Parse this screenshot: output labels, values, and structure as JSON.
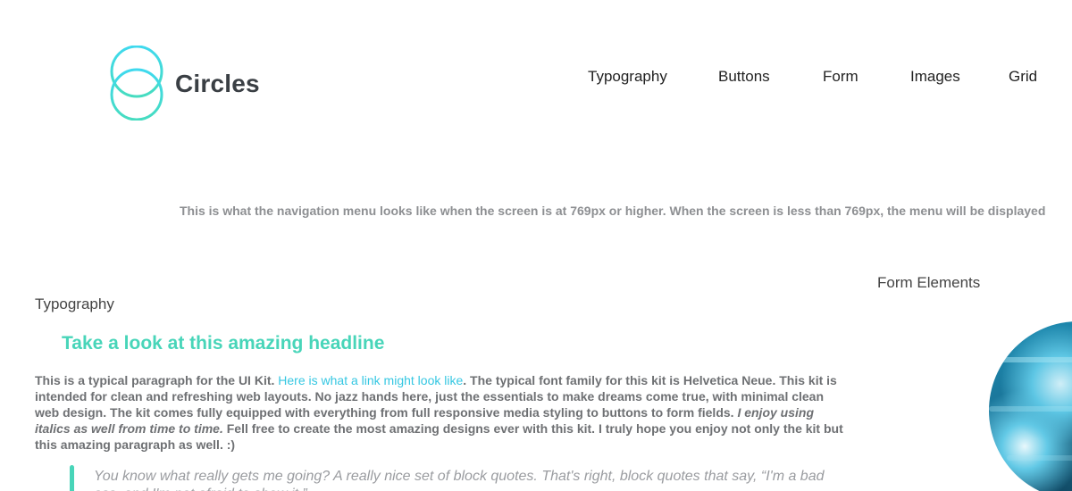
{
  "brand": {
    "name": "Circles",
    "logo_icon": "circles-logo-icon",
    "accent_color": "#48d5b9",
    "link_color": "#35c7e2"
  },
  "nav": {
    "items": [
      {
        "label": "Typography"
      },
      {
        "label": "Buttons"
      },
      {
        "label": "Form"
      },
      {
        "label": "Images"
      },
      {
        "label": "Grid"
      }
    ]
  },
  "info_text": "This is what the navigation menu looks like when the screen is at 769px or higher. When the screen is less than 769px, the menu will be displayed",
  "typography": {
    "title": "Typography",
    "headline": "Take a look at this amazing headline",
    "paragraph": {
      "intro": "This is a typical paragraph for the UI Kit. ",
      "link": "Here is what a link might look like",
      "middle": ". The typical font family for this kit is Helvetica Neue. This kit is intended for clean and refreshing web layouts. No jazz hands here, just the essentials to make dreams come true, with minimal clean web design. The kit comes fully equipped with everything from full responsive media styling to buttons to form fields. ",
      "italic": "I enjoy using italics as well from time to time.",
      "end": " Fell free to create the most amazing designs ever with this kit. I truly hope you enjoy not only the kit but this amazing paragraph as well. :)"
    },
    "blockquote": "You know what really gets me going? A really nice set of block quotes. That's right, block quotes that say, “I'm a bad ass, and I'm not afraid to show it.”"
  },
  "form_elements": {
    "title": "Form Elements",
    "image_icon": "ocean-wave-image"
  }
}
